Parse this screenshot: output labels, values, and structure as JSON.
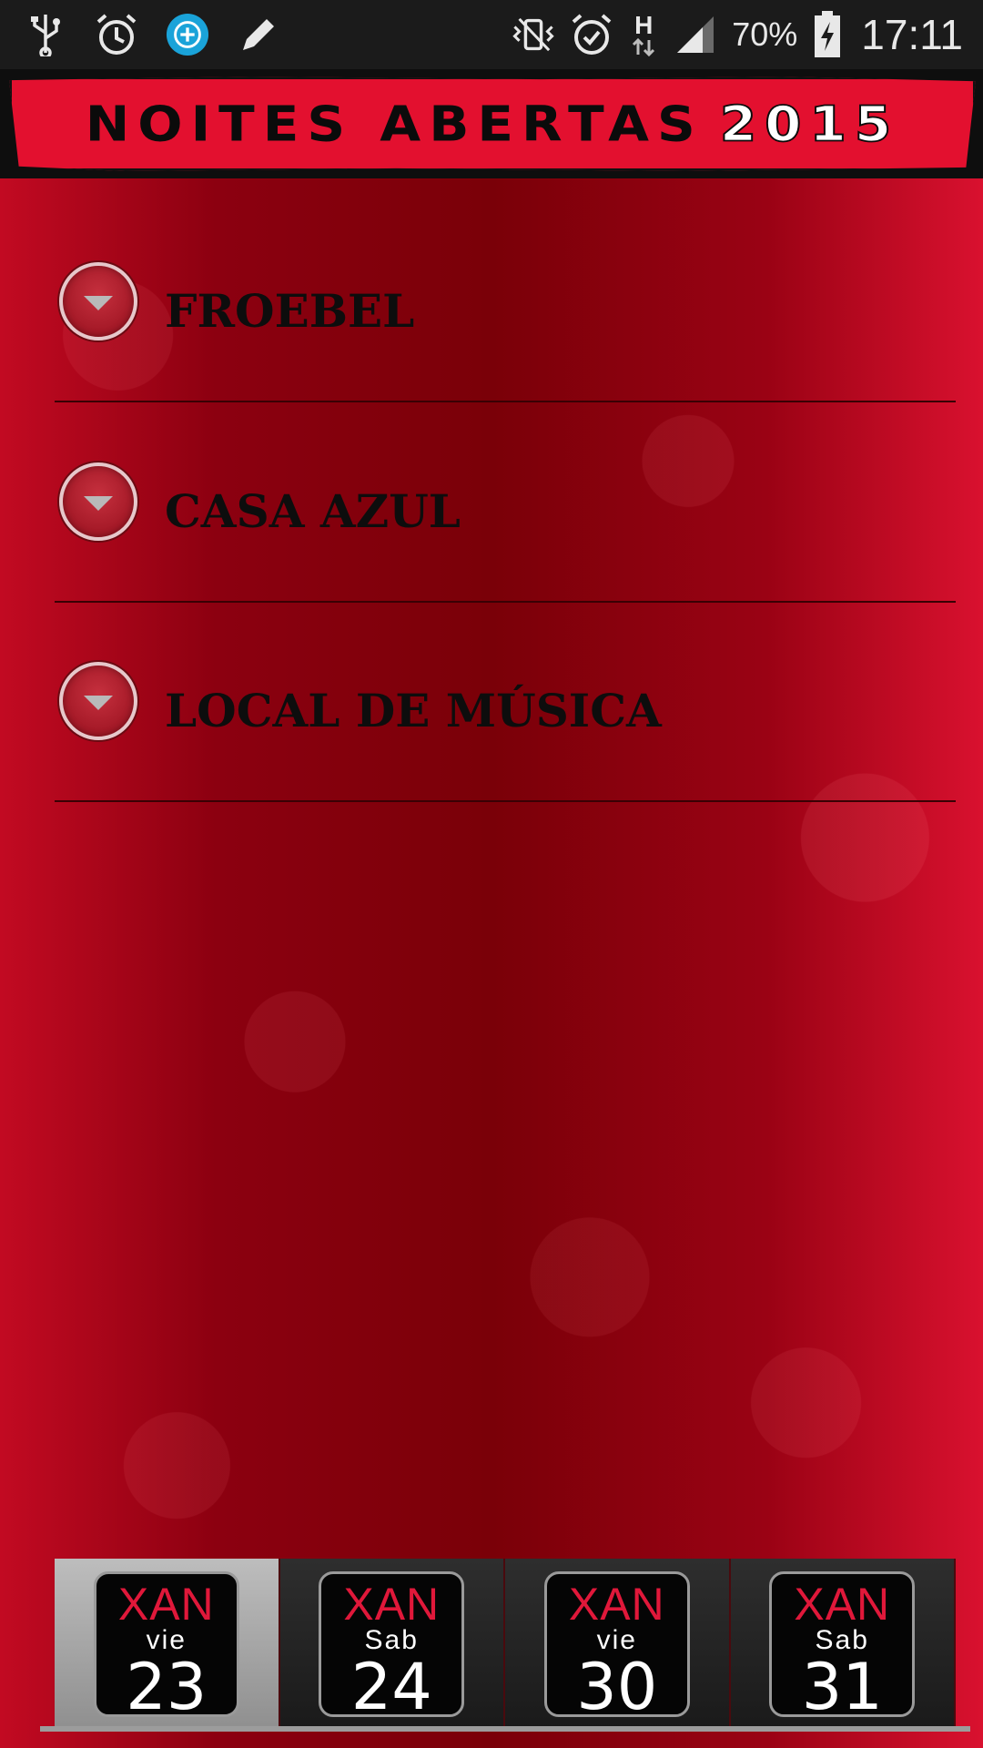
{
  "status_bar": {
    "battery": "70%",
    "network": "H",
    "time": "17:11",
    "icons_left": [
      "usb-icon",
      "alarm-clock-icon",
      "sync-add-icon",
      "pencil-icon"
    ],
    "icons_right": [
      "vibrate-mute-icon",
      "alarm-icon",
      "data-arrows-icon",
      "signal-icon",
      "battery-charging-icon"
    ]
  },
  "header": {
    "title": "NOITES ABERTAS",
    "year": "2015",
    "colors": {
      "banner": "#e3102f",
      "text": "#0b0b0b"
    }
  },
  "venues": [
    {
      "label": "FROEBEL"
    },
    {
      "label": "CASA AZUL"
    },
    {
      "label": "LOCAL DE MÚSICA"
    }
  ],
  "dates": [
    {
      "month": "XAN",
      "weekday": "vie",
      "day": "23",
      "selected": true
    },
    {
      "month": "XAN",
      "weekday": "Sab",
      "day": "24",
      "selected": false
    },
    {
      "month": "XAN",
      "weekday": "vie",
      "day": "30",
      "selected": false
    },
    {
      "month": "XAN",
      "weekday": "Sab",
      "day": "31",
      "selected": false
    }
  ],
  "theme": {
    "background": "#7a0008",
    "accent": "#e0183a"
  }
}
